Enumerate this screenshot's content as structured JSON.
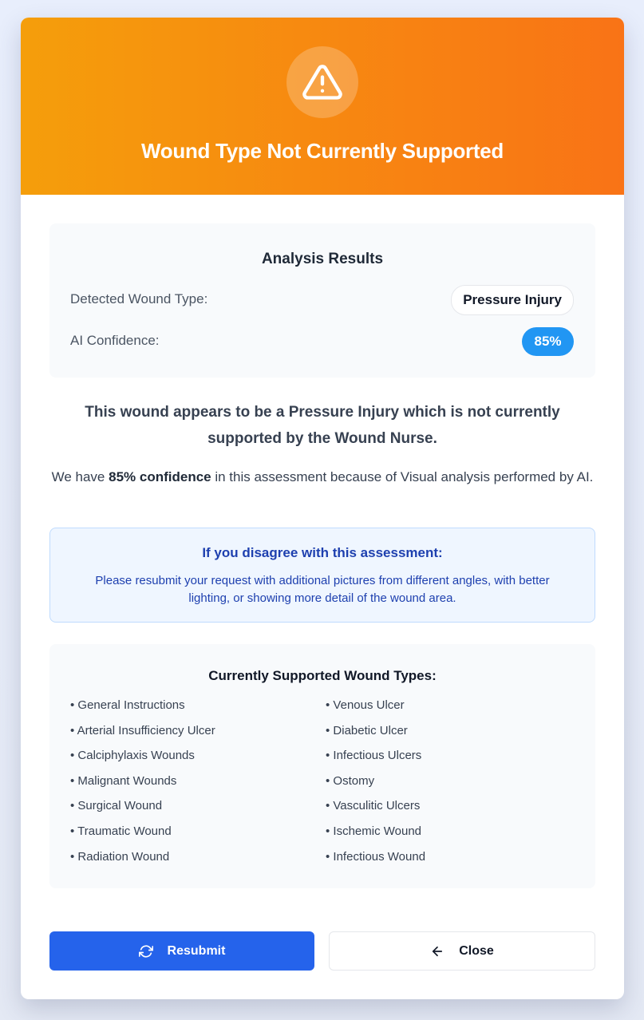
{
  "header": {
    "title": "Wound Type Not Currently Supported",
    "icon": "warning-triangle-icon",
    "gradient_start": "#f59e0b",
    "gradient_end": "#f97316"
  },
  "analysis": {
    "title": "Analysis Results",
    "detected_label": "Detected Wound Type:",
    "detected_value": "Pressure Injury",
    "confidence_label": "AI Confidence:",
    "confidence_value": "85%",
    "confidence_color": "#2196f3"
  },
  "statement": "This wound appears to be a Pressure Injury which is not currently supported by the Wound Nurse.",
  "confidence_text": {
    "prefix": "We have ",
    "bold": "85% confidence",
    "suffix": " in this assessment because of Visual analysis performed by AI."
  },
  "disagree": {
    "title": "If you disagree with this assessment:",
    "body": "Please resubmit your request with additional pictures from different angles, with better lighting, or showing more detail of the wound area."
  },
  "supported": {
    "title": "Currently Supported Wound Types:",
    "items": [
      "• General Instructions",
      "• Venous Ulcer",
      "• Arterial Insufficiency Ulcer",
      "• Diabetic Ulcer",
      "• Calciphylaxis Wounds",
      "• Infectious Ulcers",
      "• Malignant Wounds",
      "• Ostomy",
      "• Surgical Wound",
      "• Vasculitic Ulcers",
      "• Traumatic Wound",
      "• Ischemic Wound",
      "• Radiation Wound",
      "• Infectious Wound"
    ]
  },
  "buttons": {
    "resubmit_label": "Resubmit",
    "resubmit_icon": "refresh-icon",
    "resubmit_color": "#2563eb",
    "close_label": "Close",
    "close_icon": "arrow-left-icon"
  }
}
